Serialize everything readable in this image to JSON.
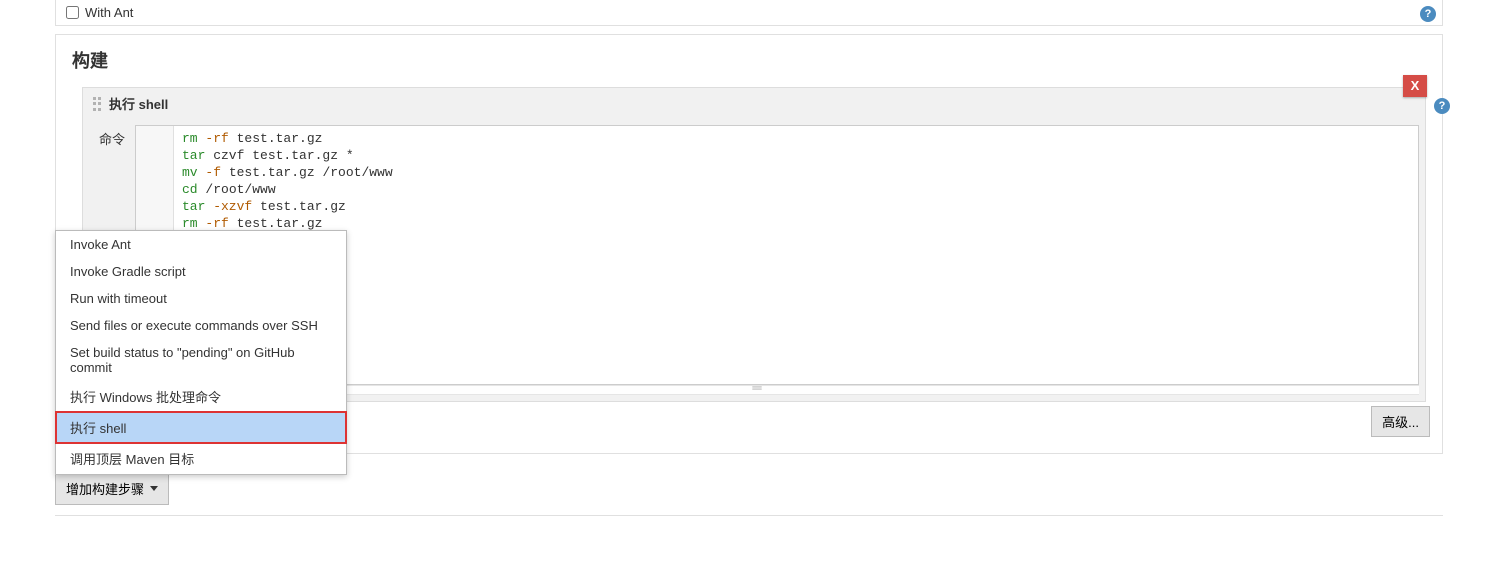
{
  "ant_checkbox": {
    "label": "With Ant"
  },
  "build": {
    "heading": "构建",
    "step": {
      "title": "执行 shell",
      "close_label": "X",
      "command_label": "命令",
      "code_lines": [
        [
          {
            "cls": "kw-rm",
            "t": "rm"
          },
          {
            "cls": "flag",
            "t": " -rf "
          },
          {
            "cls": "",
            "t": "test.tar.gz"
          }
        ],
        [
          {
            "cls": "kw-tar",
            "t": "tar"
          },
          {
            "cls": "",
            "t": " czvf test.tar.gz *"
          }
        ],
        [
          {
            "cls": "kw-mv",
            "t": "mv"
          },
          {
            "cls": "flag",
            "t": " -f "
          },
          {
            "cls": "",
            "t": "test.tar.gz /root/www"
          }
        ],
        [
          {
            "cls": "kw-cd",
            "t": "cd"
          },
          {
            "cls": "",
            "t": " /root/www"
          }
        ],
        [
          {
            "cls": "kw-tar",
            "t": "tar"
          },
          {
            "cls": "flag",
            "t": " -xzvf "
          },
          {
            "cls": "",
            "t": "test.tar.gz"
          }
        ],
        [
          {
            "cls": "kw-rm",
            "t": "rm"
          },
          {
            "cls": "flag",
            "t": " -rf "
          },
          {
            "cls": "",
            "t": "test.tar.gz"
          }
        ]
      ]
    },
    "add_step_label": "增加构建步骤",
    "advanced_label": "高级...",
    "menu": {
      "items": [
        "Invoke Ant",
        "Invoke Gradle script",
        "Run with timeout",
        "Send files or execute commands over SSH",
        "Set build status to \"pending\" on GitHub commit",
        "执行 Windows 批处理命令",
        "执行 shell",
        "调用顶层 Maven 目标"
      ],
      "highlighted_index": 6
    }
  },
  "help_glyph": "?"
}
